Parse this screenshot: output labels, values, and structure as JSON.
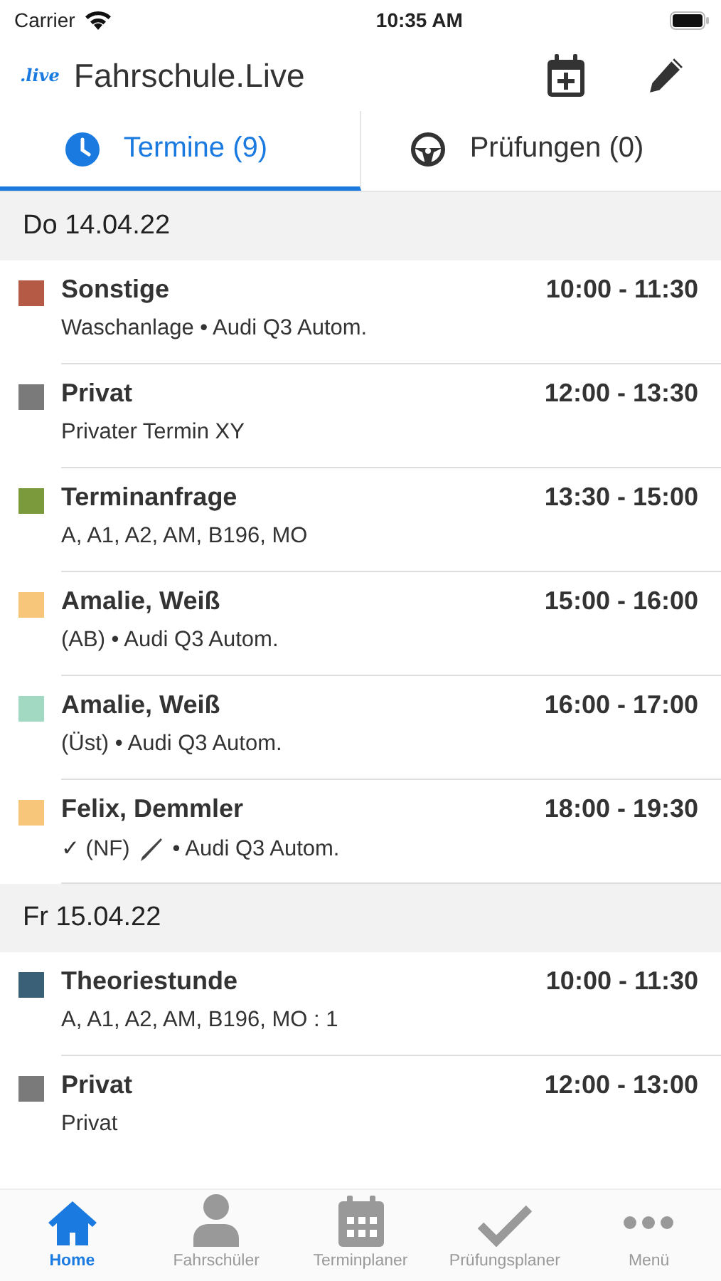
{
  "status_bar": {
    "carrier": "Carrier",
    "time": "10:35 AM"
  },
  "header": {
    "logo": ".live",
    "title": "Fahrschule.Live"
  },
  "tabs": [
    {
      "label": "Termine (9)",
      "kind": "clock",
      "selected": true
    },
    {
      "label": "Prüfungen (0)",
      "kind": "wheel",
      "selected": false
    }
  ],
  "days": [
    {
      "date": "Do 14.04.22",
      "entries": [
        {
          "title": "Sonstige",
          "time": "10:00 - 11:30",
          "color": "#b55a45",
          "subtitle": [
            {
              "kind": "text",
              "text": "Waschanlage • Audi Q3 Autom."
            }
          ]
        },
        {
          "title": "Privat",
          "time": "12:00 - 13:30",
          "color": "#7a7a7a",
          "subtitle": [
            {
              "kind": "text",
              "text": "Privater Termin XY"
            }
          ]
        },
        {
          "title": "Terminanfrage",
          "time": "13:30 - 15:00",
          "color": "#7a9a3c",
          "subtitle": [
            {
              "kind": "text",
              "text": "A, A1, A2, AM, B196, MO"
            }
          ]
        },
        {
          "title": "Amalie, Weiß",
          "time": "15:00 - 16:00",
          "color": "#f8c67a",
          "subtitle": [
            {
              "kind": "text",
              "text": "(AB) • Audi Q3 Autom."
            }
          ]
        },
        {
          "title": "Amalie, Weiß",
          "time": "16:00 - 17:00",
          "color": "#a2d9c2",
          "subtitle": [
            {
              "kind": "text",
              "text": "(Üst) • Audi Q3 Autom."
            }
          ]
        },
        {
          "title": "Felix, Demmler",
          "time": "18:00 - 19:30",
          "color": "#f8c67a",
          "subtitle": [
            {
              "kind": "text",
              "text": "✓ (NF)"
            },
            {
              "kind": "pen"
            },
            {
              "kind": "text",
              "text": "• Audi Q3 Autom."
            }
          ]
        }
      ]
    },
    {
      "date": "Fr 15.04.22",
      "entries": [
        {
          "title": "Theoriestunde",
          "time": "10:00 - 11:30",
          "color": "#3a6078",
          "subtitle": [
            {
              "kind": "text",
              "text": "A, A1, A2, AM, B196, MO : 1"
            }
          ]
        },
        {
          "title": "Privat",
          "time": "12:00 - 13:00",
          "color": "#7a7a7a",
          "subtitle": [
            {
              "kind": "text",
              "text": "Privat"
            }
          ]
        }
      ]
    }
  ],
  "tab_bar": [
    {
      "label": "Home",
      "kind": "home",
      "selected": true
    },
    {
      "label": "Fahrschüler",
      "kind": "person",
      "selected": false
    },
    {
      "label": "Terminplaner",
      "kind": "calendar",
      "selected": false
    },
    {
      "label": "Prüfungsplaner",
      "kind": "check",
      "selected": false
    },
    {
      "label": "Menü",
      "kind": "dots",
      "selected": false
    }
  ]
}
